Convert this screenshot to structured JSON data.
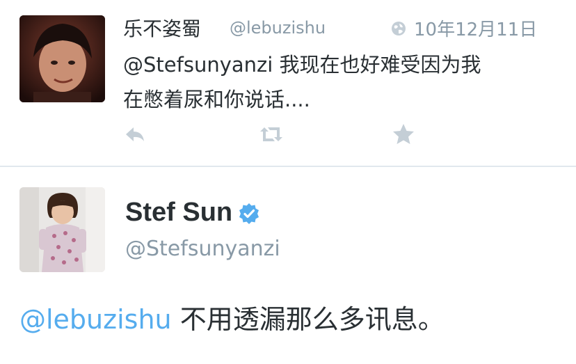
{
  "tweet_reply": {
    "display_name": "乐不姿蜀",
    "handle": "@lebuzishu",
    "timestamp": "10年12月11日",
    "mention": "@Stefsunyanzi",
    "text_line1": " 我现在也好难受因为我",
    "text_line2": "在憋着尿和你说话....",
    "actions": [
      "reply-icon",
      "retweet-icon",
      "favorite-icon"
    ],
    "timestamp_icon": "globe-icon"
  },
  "tweet_main": {
    "display_name": "Stef Sun",
    "verified_icon": "verified-badge-icon",
    "handle": "@Stefsunyanzi",
    "mention": "@lebuzishu",
    "text": " 不用透漏那么多讯息。"
  },
  "colors": {
    "link": "#55acee",
    "muted": "#8899a6",
    "icon": "#c4ced6",
    "text": "#292f33",
    "divider": "#e1e8ed"
  }
}
